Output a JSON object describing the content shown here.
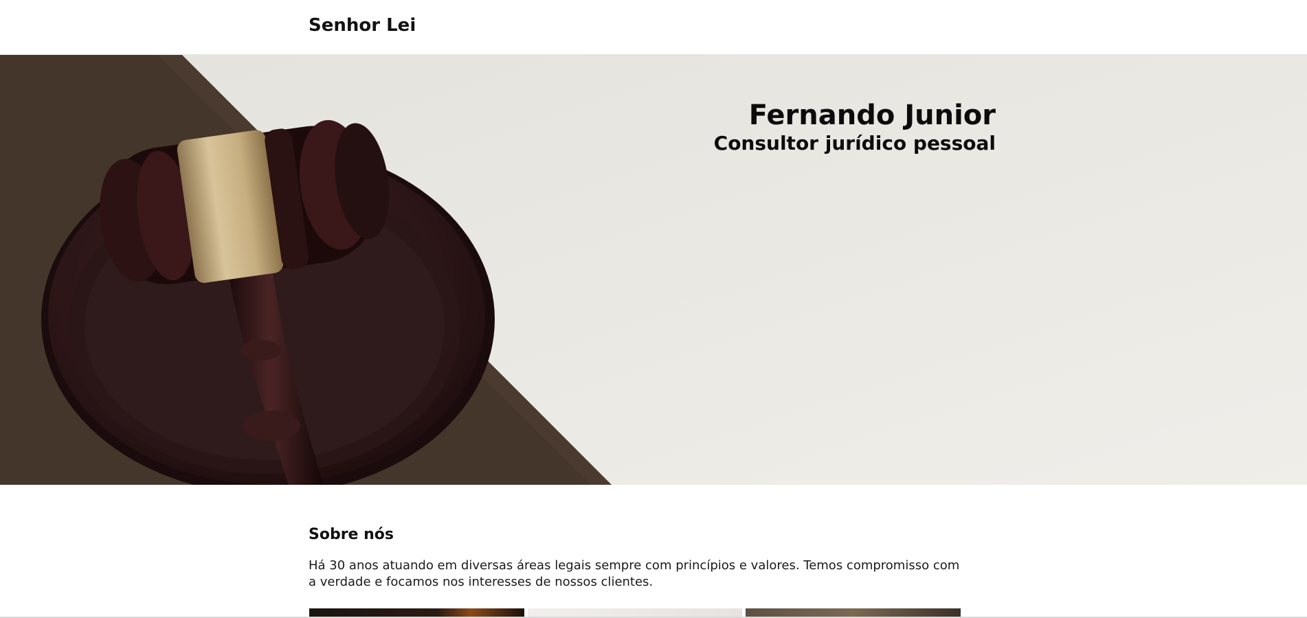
{
  "header": {
    "brand": "Senhor Lei"
  },
  "hero": {
    "name": "Fernando Junior",
    "subtitle": "Consultor jurídico pessoal",
    "image": "gavel-on-sound-block"
  },
  "about": {
    "title": "Sobre nós",
    "text": "Há 30 anos atuando em diversas áreas legais sempre com princípios e valores. Temos compromisso com a verdade e focamos nos interesses de nossos clientes."
  },
  "colors": {
    "text": "#111111",
    "hero_bg": "#e9e8e3",
    "wood": "#3a1d1c",
    "brass": "#c2aa7a"
  }
}
